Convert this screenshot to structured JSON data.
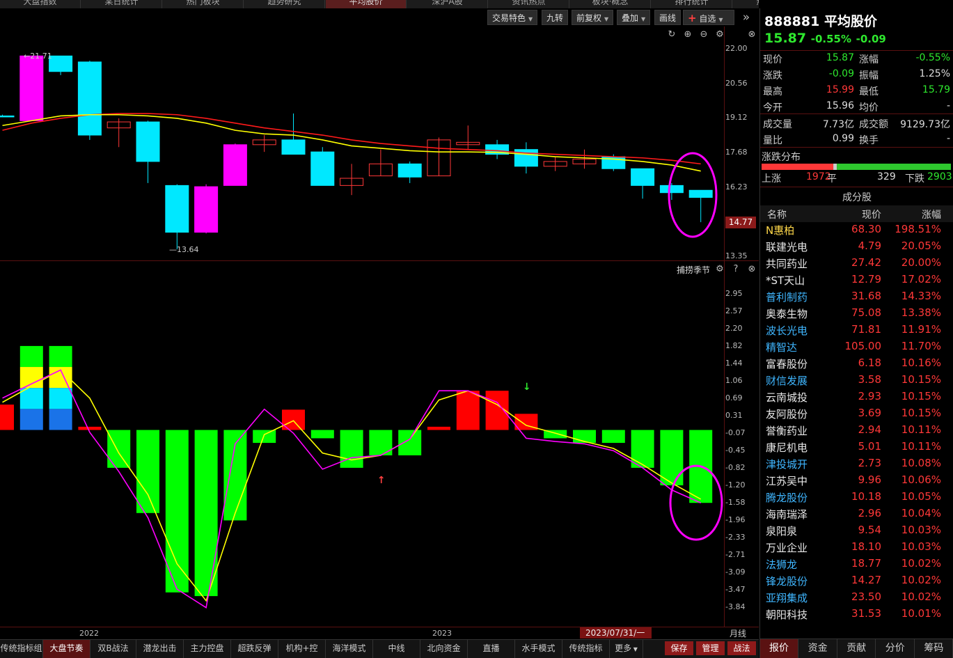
{
  "top_tabs": {
    "active_index": 5,
    "items": [
      "大盘指数",
      "某日统计",
      "热门板块",
      "趋势研究",
      "平均股价",
      "深沪A股",
      "资讯热点",
      "板块·概念",
      "排行统计",
      "热点观测"
    ]
  },
  "toolbar": {
    "jiaoyi": "交易特色",
    "jiuzhuan": "九转",
    "qianfuquan": "前复权",
    "diejia": "叠加",
    "huaxian": "画线",
    "zixuan": "自选"
  },
  "main_chart": {
    "y_labels": [
      "22.00",
      "20.56",
      "19.12",
      "17.68",
      "16.23",
      "14.77",
      "13.35"
    ],
    "current_price_label": "14.77",
    "high_marker": "21.71",
    "low_marker": "13.64"
  },
  "sub_chart": {
    "indicator_name": "捕捞季节",
    "y_labels": [
      "2.95",
      "2.57",
      "2.20",
      "1.82",
      "1.44",
      "1.06",
      "0.69",
      "0.31",
      "-0.07",
      "-0.45",
      "-0.82",
      "-1.20",
      "-1.58",
      "-1.96",
      "-2.33",
      "-2.71",
      "-3.09",
      "-3.47",
      "-3.84"
    ]
  },
  "chart_data": {
    "type": "candlestick",
    "period": "月线",
    "x_ticks": [
      "2022",
      "2023"
    ],
    "candles": [
      {
        "open": 19.2,
        "close": 19.2,
        "high": 19.25,
        "low": 19.15,
        "color": "cyan"
      },
      {
        "open": 19.0,
        "close": 21.7,
        "high": 21.71,
        "low": 19.0,
        "color": "magenta"
      },
      {
        "open": 21.7,
        "close": 21.05,
        "high": 21.7,
        "low": 20.9,
        "color": "cyan"
      },
      {
        "open": 21.45,
        "close": 18.4,
        "high": 21.5,
        "low": 18.2,
        "color": "cyan"
      },
      {
        "open": 18.7,
        "close": 18.95,
        "high": 19.1,
        "low": 17.9,
        "color": "red-hollow"
      },
      {
        "open": 18.95,
        "close": 17.3,
        "high": 19.0,
        "low": 16.4,
        "color": "cyan"
      },
      {
        "open": 16.3,
        "close": 14.35,
        "high": 16.35,
        "low": 13.64,
        "color": "cyan"
      },
      {
        "open": 14.35,
        "close": 16.25,
        "high": 16.35,
        "low": 14.3,
        "color": "magenta"
      },
      {
        "open": 16.3,
        "close": 18.0,
        "high": 18.05,
        "low": 16.3,
        "color": "magenta"
      },
      {
        "open": 18.0,
        "close": 18.2,
        "high": 18.4,
        "low": 17.7,
        "color": "red-hollow"
      },
      {
        "open": 18.2,
        "close": 17.6,
        "high": 19.3,
        "low": 17.6,
        "color": "cyan"
      },
      {
        "open": 17.7,
        "close": 16.3,
        "high": 17.9,
        "low": 16.3,
        "color": "cyan"
      },
      {
        "open": 16.3,
        "close": 16.6,
        "high": 17.2,
        "low": 15.9,
        "color": "red-hollow"
      },
      {
        "open": 16.7,
        "close": 17.2,
        "high": 17.8,
        "low": 16.7,
        "color": "red-hollow"
      },
      {
        "open": 17.2,
        "close": 16.65,
        "high": 17.3,
        "low": 16.4,
        "color": "cyan"
      },
      {
        "open": 16.7,
        "close": 18.2,
        "high": 18.3,
        "low": 16.7,
        "color": "red-hollow"
      },
      {
        "open": 18.0,
        "close": 18.1,
        "high": 18.8,
        "low": 17.8,
        "color": "red-hollow"
      },
      {
        "open": 18.0,
        "close": 17.6,
        "high": 18.2,
        "low": 17.4,
        "color": "cyan"
      },
      {
        "open": 17.8,
        "close": 17.1,
        "high": 18.1,
        "low": 16.8,
        "color": "cyan"
      },
      {
        "open": 17.1,
        "close": 17.3,
        "high": 17.5,
        "low": 16.9,
        "color": "red-hollow"
      },
      {
        "open": 17.2,
        "close": 17.4,
        "high": 17.8,
        "low": 17.0,
        "color": "red-hollow"
      },
      {
        "open": 17.5,
        "close": 17.0,
        "high": 17.6,
        "low": 16.9,
        "color": "cyan"
      },
      {
        "open": 17.0,
        "close": 16.3,
        "high": 17.0,
        "low": 15.75,
        "color": "cyan"
      },
      {
        "open": 16.3,
        "close": 16.0,
        "high": 16.4,
        "low": 15.7,
        "color": "cyan"
      },
      {
        "open": 16.1,
        "close": 15.8,
        "high": 16.1,
        "low": 14.77,
        "color": "cyan"
      }
    ],
    "ma_yellow": [
      18.8,
      19.0,
      19.2,
      19.25,
      19.25,
      19.2,
      19.1,
      18.9,
      18.6,
      18.45,
      18.4,
      18.2,
      17.95,
      17.85,
      17.75,
      17.7,
      17.7,
      17.68,
      17.6,
      17.5,
      17.45,
      17.4,
      17.3,
      17.15,
      16.9
    ],
    "ma_red": [
      18.6,
      18.9,
      19.1,
      19.25,
      19.3,
      19.3,
      19.25,
      19.1,
      18.9,
      18.7,
      18.55,
      18.4,
      18.2,
      18.05,
      17.95,
      17.85,
      17.8,
      17.75,
      17.65,
      17.6,
      17.55,
      17.5,
      17.45,
      17.35,
      17.2
    ],
    "sub_bars": [
      {
        "value": 0.55,
        "color": "red"
      },
      {
        "value": 1.82,
        "color": "stack"
      },
      {
        "value": 1.82,
        "color": "stack"
      },
      {
        "value": 0.07,
        "color": "red"
      },
      {
        "value": -0.82,
        "color": "green"
      },
      {
        "value": -1.8,
        "color": "green"
      },
      {
        "value": -3.52,
        "color": "green"
      },
      {
        "value": -3.6,
        "color": "green"
      },
      {
        "value": -1.96,
        "color": "green"
      },
      {
        "value": -0.28,
        "color": "green"
      },
      {
        "value": 0.44,
        "color": "red"
      },
      {
        "value": -0.18,
        "color": "green"
      },
      {
        "value": -0.82,
        "color": "green"
      },
      {
        "value": -0.55,
        "color": "green"
      },
      {
        "value": -0.55,
        "color": "green"
      },
      {
        "value": 0.07,
        "color": "red"
      },
      {
        "value": 0.85,
        "color": "red"
      },
      {
        "value": 0.85,
        "color": "red"
      },
      {
        "value": 0.35,
        "color": "red"
      },
      {
        "value": -0.18,
        "color": "green"
      },
      {
        "value": -0.28,
        "color": "green"
      },
      {
        "value": -0.28,
        "color": "green"
      },
      {
        "value": -0.82,
        "color": "green"
      },
      {
        "value": -1.2,
        "color": "green"
      },
      {
        "value": -1.58,
        "color": "green"
      }
    ],
    "sub_line_magenta": [
      0.69,
      1.0,
      1.3,
      -0.05,
      -0.9,
      -1.9,
      -3.45,
      -3.85,
      -0.3,
      0.45,
      -0.07,
      -0.85,
      -0.6,
      -0.55,
      -0.2,
      0.85,
      0.85,
      0.6,
      -0.18,
      -0.25,
      -0.3,
      -0.45,
      -0.82,
      -1.3,
      -1.58
    ],
    "sub_line_yellow": [
      0.6,
      0.95,
      1.3,
      0.69,
      -0.5,
      -1.4,
      -2.9,
      -3.7,
      -1.8,
      -0.1,
      0.2,
      -0.5,
      -0.65,
      -0.55,
      -0.2,
      0.65,
      0.85,
      0.55,
      0.1,
      -0.07,
      -0.25,
      -0.4,
      -0.75,
      -1.15,
      -1.5
    ],
    "arrows": [
      {
        "index": 13,
        "dir": "up",
        "value": -0.82
      },
      {
        "index": 18,
        "dir": "down",
        "value": 0.69
      }
    ]
  },
  "xaxis": {
    "year_2022": "2022",
    "year_2023": "2023",
    "date_box": "2023/07/31/一",
    "period": "月线"
  },
  "bottom_tabs": [
    "传统指标组",
    "大盘节奏",
    "双B战法",
    "潜龙出击",
    "主力控盘",
    "超跌反弹",
    "机构+控盘...",
    "海洋模式",
    "中线",
    "北向资金",
    "直播",
    "水手模式",
    "传统指标",
    "更多"
  ],
  "bottom_active": 1,
  "bottom_right_buttons": [
    "保存",
    "管理",
    "战法"
  ],
  "panel": {
    "code": "888881",
    "name": "平均股价",
    "price": "15.87",
    "change_pct": "-0.55%",
    "change": "-0.09",
    "quote": {
      "xianjia_l": "现价",
      "xianjia": "15.87",
      "zhangfu_l": "涨幅",
      "zhangfu": "-0.55%",
      "zhangdie_l": "涨跌",
      "zhangdie": "-0.09",
      "zhenfu_l": "振幅",
      "zhenfu": "1.25%",
      "zuigao_l": "最高",
      "zuigao": "15.99",
      "zuidi_l": "最低",
      "zuidi": "15.79",
      "jinkai_l": "今开",
      "jinkai": "15.96",
      "junjia_l": "均价",
      "junjia": "-",
      "cjl_l": "成交量",
      "cjl": "7.73亿",
      "cje_l": "成交额",
      "cje": "9129.73亿",
      "liangbi_l": "量比",
      "liangbi": "0.99",
      "huanshou_l": "换手",
      "huanshou": "-"
    },
    "dist": {
      "title": "涨跌分布",
      "up_l": "上涨",
      "up": "1972",
      "flat_l": "平",
      "flat": "329",
      "down_l": "下跌",
      "down": "2903"
    },
    "constituents": {
      "title": "成分股",
      "headers": [
        "名称",
        "现价",
        "涨幅"
      ],
      "rows": [
        {
          "name": "N惠柏",
          "price": "68.30",
          "pct": "198.51%",
          "nc": "#ffd84a"
        },
        {
          "name": "联建光电",
          "price": "4.79",
          "pct": "20.05%",
          "nc": "#e8e8e8"
        },
        {
          "name": "共同药业",
          "price": "27.42",
          "pct": "20.00%",
          "nc": "#e8e8e8"
        },
        {
          "name": "*ST天山",
          "price": "12.79",
          "pct": "17.02%",
          "nc": "#e8e8e8"
        },
        {
          "name": "普利制药",
          "price": "31.68",
          "pct": "14.33%",
          "nc": "#3fb6ff"
        },
        {
          "name": "奥泰生物",
          "price": "75.08",
          "pct": "13.38%",
          "nc": "#e8e8e8"
        },
        {
          "name": "波长光电",
          "price": "71.81",
          "pct": "11.91%",
          "nc": "#3fb6ff"
        },
        {
          "name": "精智达",
          "price": "105.00",
          "pct": "11.70%",
          "nc": "#3fb6ff"
        },
        {
          "name": "富春股份",
          "price": "6.18",
          "pct": "10.16%",
          "nc": "#e8e8e8"
        },
        {
          "name": "财信发展",
          "price": "3.58",
          "pct": "10.15%",
          "nc": "#3fb6ff"
        },
        {
          "name": "云南城投",
          "price": "2.93",
          "pct": "10.15%",
          "nc": "#e8e8e8"
        },
        {
          "name": "友阿股份",
          "price": "3.69",
          "pct": "10.15%",
          "nc": "#e8e8e8"
        },
        {
          "name": "誉衡药业",
          "price": "2.94",
          "pct": "10.11%",
          "nc": "#e8e8e8"
        },
        {
          "name": "康尼机电",
          "price": "5.01",
          "pct": "10.11%",
          "nc": "#e8e8e8"
        },
        {
          "name": "津投城开",
          "price": "2.73",
          "pct": "10.08%",
          "nc": "#3fb6ff"
        },
        {
          "name": "江苏吴中",
          "price": "9.96",
          "pct": "10.06%",
          "nc": "#e8e8e8"
        },
        {
          "name": "腾龙股份",
          "price": "10.18",
          "pct": "10.05%",
          "nc": "#3fb6ff"
        },
        {
          "name": "海南瑞泽",
          "price": "2.96",
          "pct": "10.04%",
          "nc": "#e8e8e8"
        },
        {
          "name": "泉阳泉",
          "price": "9.54",
          "pct": "10.03%",
          "nc": "#e8e8e8"
        },
        {
          "name": "万业企业",
          "price": "18.10",
          "pct": "10.03%",
          "nc": "#e8e8e8"
        },
        {
          "name": "法狮龙",
          "price": "18.77",
          "pct": "10.02%",
          "nc": "#3fb6ff"
        },
        {
          "name": "锋龙股份",
          "price": "14.27",
          "pct": "10.02%",
          "nc": "#3fb6ff"
        },
        {
          "name": "亚翔集成",
          "price": "23.50",
          "pct": "10.02%",
          "nc": "#3fb6ff"
        },
        {
          "name": "朝阳科技",
          "price": "31.53",
          "pct": "10.01%",
          "nc": "#e8e8e8"
        }
      ]
    },
    "right_tabs": [
      "报价",
      "资金",
      "贡献",
      "分价",
      "筹码"
    ],
    "right_active": 0
  },
  "colors": {
    "up": "#ff3838",
    "down": "#2ee82e",
    "cyan": "#00e8ff",
    "magenta": "#ff00ff",
    "yellow": "#ffff00",
    "ma_red": "#ff1a1a"
  }
}
